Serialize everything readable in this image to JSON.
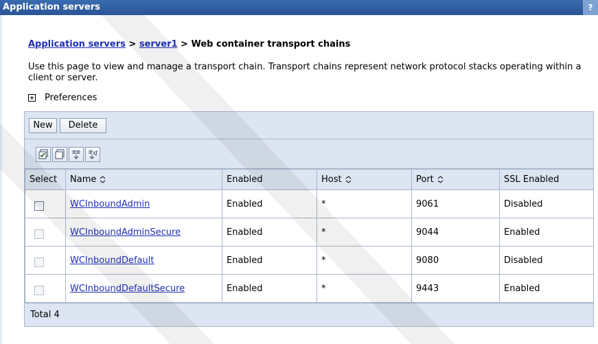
{
  "window": {
    "title": "Application servers",
    "help_label": "?"
  },
  "breadcrumb": {
    "items": [
      "Application servers",
      "server1"
    ],
    "separator": " > ",
    "current": "Web container transport chains"
  },
  "description": "Use this page to view and manage a transport chain. Transport chains represent network protocol stacks operating within a client or server.",
  "preferences": {
    "label": "Preferences"
  },
  "toolbar": {
    "new_label": "New",
    "delete_label": "Delete"
  },
  "icon_toolbar": [
    "select-all-icon",
    "deselect-all-icon",
    "show-filter-icon",
    "clear-filter-icon"
  ],
  "table": {
    "headers": {
      "select": "Select",
      "name": "Name",
      "enabled": "Enabled",
      "host": "Host",
      "port": "Port",
      "ssl": "SSL Enabled"
    },
    "rows": [
      {
        "name": "WCInboundAdmin",
        "enabled": "Enabled",
        "host": "*",
        "port": "9061",
        "ssl": "Disabled"
      },
      {
        "name": "WCInboundAdminSecure",
        "enabled": "Enabled",
        "host": "*",
        "port": "9044",
        "ssl": "Enabled"
      },
      {
        "name": "WCInboundDefault",
        "enabled": "Enabled",
        "host": "*",
        "port": "9080",
        "ssl": "Disabled"
      },
      {
        "name": "WCInboundDefaultSecure",
        "enabled": "Enabled",
        "host": "*",
        "port": "9443",
        "ssl": "Enabled"
      }
    ],
    "total": "Total 4"
  },
  "colors": {
    "title_bar": "#2f5c9e",
    "panel_bg": "#dce5f1",
    "link": "#1e2fb6",
    "border": "#a8b6cb"
  }
}
